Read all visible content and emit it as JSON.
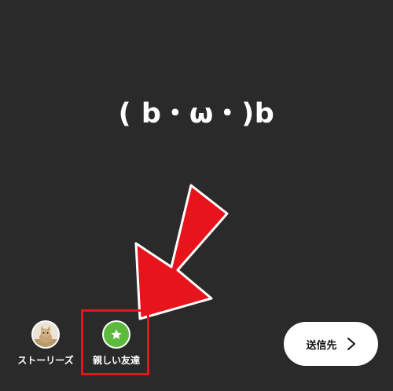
{
  "story": {
    "text": "( b・ω・)b"
  },
  "share_options": {
    "stories_label": "ストーリーズ",
    "close_friends_label": "親しい友達"
  },
  "send_button": {
    "label": "送信先",
    "icon": "chevron-right-icon"
  },
  "icons": {
    "avatar": "profile-avatar-cat",
    "close_friends": "star-icon",
    "annotation": "red-arrow-icon"
  },
  "colors": {
    "background": "#2a2a2a",
    "close_friends_green": "#5cbb3c",
    "annotation_red": "#e8141c",
    "button_white": "#ffffff"
  }
}
